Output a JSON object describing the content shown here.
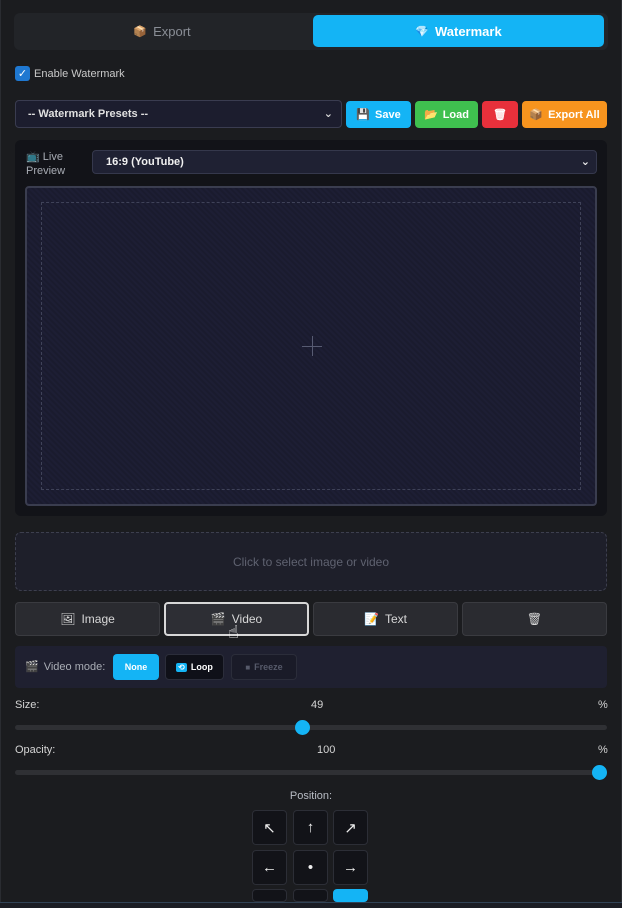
{
  "tabs": {
    "export": {
      "label": "Export",
      "icon": "package-icon"
    },
    "watermark": {
      "label": "Watermark",
      "icon": "diamond-icon"
    }
  },
  "enable_watermark": {
    "label": "Enable Watermark",
    "checked": true
  },
  "presets": {
    "selected": "-- Watermark Presets --",
    "save_label": "Save",
    "load_label": "Load",
    "delete_icon": "trash-icon",
    "export_all_label": "Export All"
  },
  "preview": {
    "label": "Live Preview",
    "aspect_ratio": "16:9 (YouTube)"
  },
  "dropzone": {
    "text": "Click to select image or video"
  },
  "media_buttons": {
    "image": "Image",
    "video": "Video",
    "text": "Text",
    "clear_icon": "trash-icon"
  },
  "video_mode": {
    "label": "Video mode:",
    "options": [
      "None",
      "Loop",
      "Freeze"
    ],
    "selected": "None"
  },
  "size": {
    "label": "Size:",
    "value": "49",
    "unit": "%"
  },
  "opacity": {
    "label": "Opacity:",
    "value": "100",
    "unit": "%"
  },
  "position": {
    "title": "Position:",
    "arrows": [
      "↖",
      "↑",
      "↗",
      "←",
      "•",
      "→"
    ],
    "selected": "bottom-right"
  },
  "colors": {
    "accent": "#14b4f5",
    "load": "#3fc04f",
    "delete": "#e7303b",
    "export_all": "#f7941e"
  }
}
